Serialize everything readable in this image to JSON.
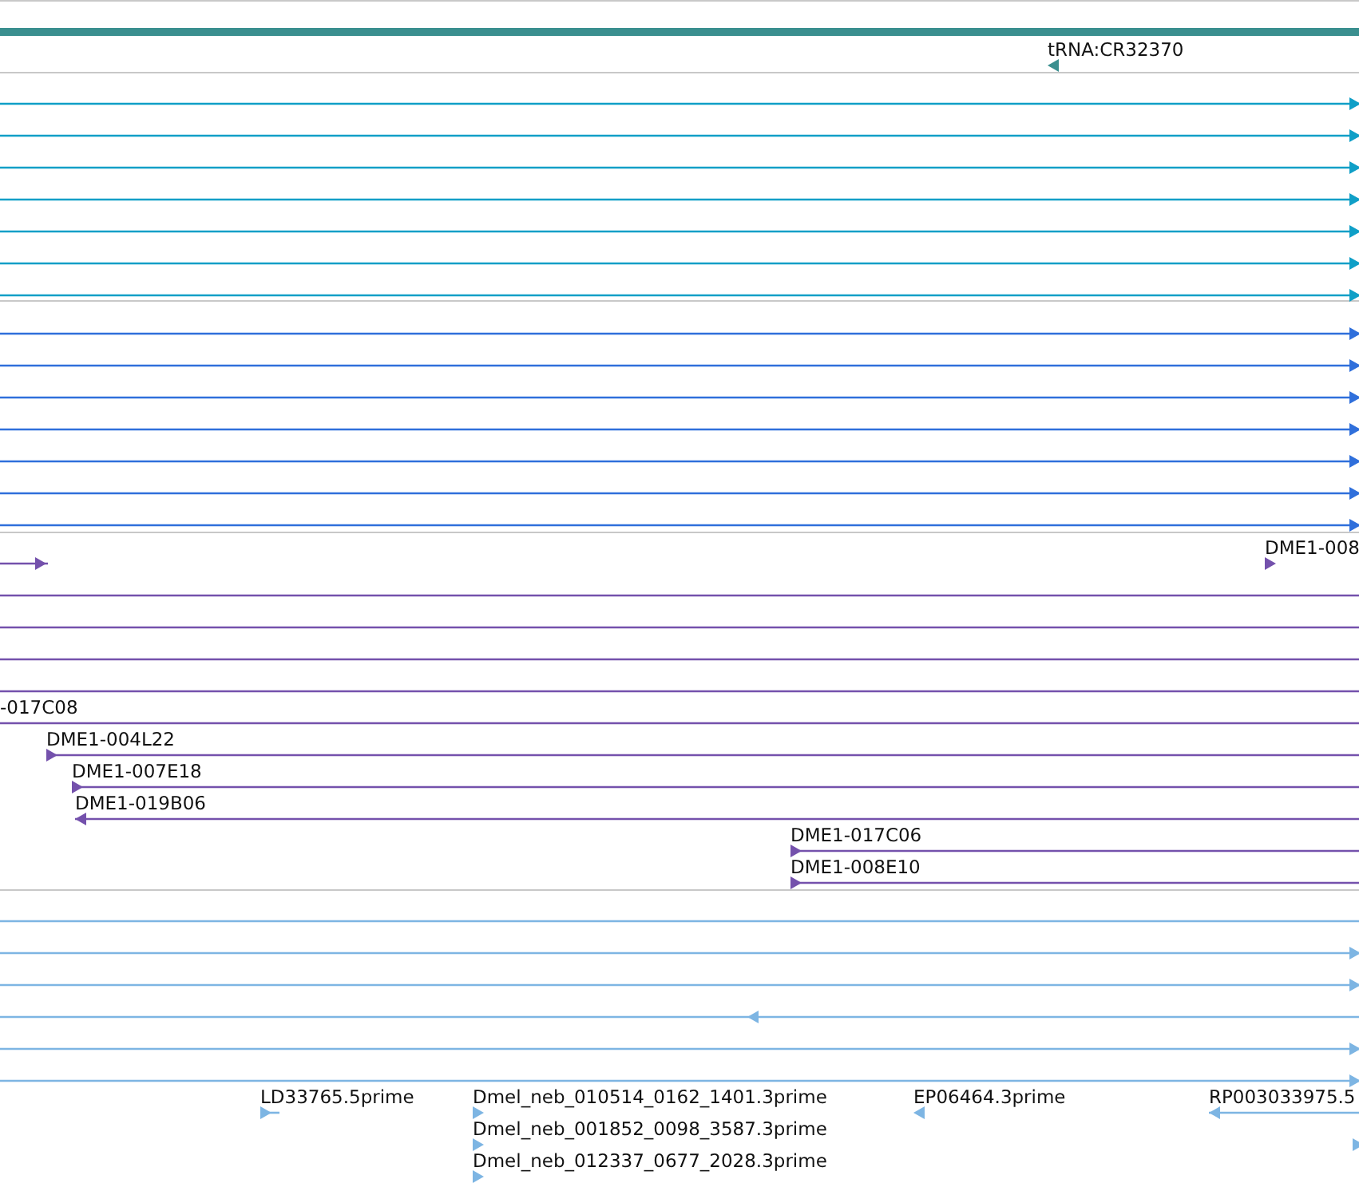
{
  "tracks": [
    {
      "color": "#3a8f8f",
      "features": [
        {
          "kind": "span"
        },
        {
          "kind": "reverse",
          "label": "tRNA:CR32370"
        }
      ]
    },
    {
      "color": "#0f9fc7",
      "features": [
        {
          "kind": "forward"
        },
        {
          "kind": "forward"
        },
        {
          "kind": "forward"
        },
        {
          "kind": "forward"
        },
        {
          "kind": "forward"
        },
        {
          "kind": "forward"
        },
        {
          "kind": "forward"
        }
      ]
    },
    {
      "color": "#2f6fdb",
      "features": [
        {
          "kind": "forward"
        },
        {
          "kind": "forward"
        },
        {
          "kind": "forward"
        },
        {
          "kind": "forward"
        },
        {
          "kind": "forward"
        },
        {
          "kind": "forward"
        },
        {
          "kind": "forward"
        }
      ]
    },
    {
      "color": "#7451ac",
      "features": [
        {
          "kind": "forward"
        },
        {
          "kind": "forward",
          "label": "DME1-008"
        },
        {
          "kind": "plain"
        },
        {
          "kind": "plain"
        },
        {
          "kind": "plain"
        },
        {
          "kind": "plain"
        },
        {
          "kind": "plain",
          "label": "-017C08"
        },
        {
          "kind": "forward",
          "label": "DME1-004L22"
        },
        {
          "kind": "forward",
          "label": "DME1-007E18"
        },
        {
          "kind": "reverse",
          "label": "DME1-019B06"
        },
        {
          "kind": "forward",
          "label": "DME1-017C06"
        },
        {
          "kind": "forward",
          "label": "DME1-008E10"
        }
      ]
    },
    {
      "color": "#7db5e3",
      "features": [
        {
          "kind": "plain"
        },
        {
          "kind": "forward"
        },
        {
          "kind": "forward"
        },
        {
          "kind": "reverse"
        },
        {
          "kind": "forward"
        },
        {
          "kind": "forward"
        },
        {
          "kind": "forward",
          "label": "LD33765.5prime"
        },
        {
          "kind": "forward",
          "label": "Dmel_neb_010514_0162_1401.3prime"
        },
        {
          "kind": "forward",
          "label": "Dmel_neb_001852_0098_3587.3prime"
        },
        {
          "kind": "forward",
          "label": "Dmel_neb_012337_0677_2028.3prime"
        },
        {
          "kind": "reverse",
          "label": "EP06464.3prime"
        },
        {
          "kind": "reverse",
          "label": "RP003033975.5"
        },
        {
          "kind": "forward"
        }
      ]
    }
  ]
}
